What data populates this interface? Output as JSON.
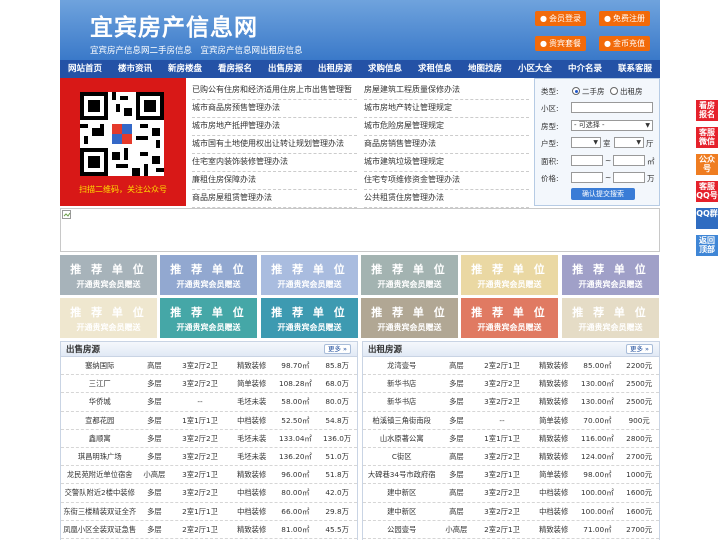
{
  "header": {
    "title": "宜宾房产信息网",
    "subtitle": "宜宾房产信息网二手房信息　宜宾房产信息网出租房信息",
    "buttons": [
      {
        "icon": "user-icon",
        "label": "会员登录"
      },
      {
        "icon": "register-icon",
        "label": "免费注册"
      },
      {
        "icon": "package-icon",
        "label": "贵宾套餐"
      },
      {
        "icon": "coin-icon",
        "label": "金币充值"
      }
    ]
  },
  "nav": [
    "网站首页",
    "楼市资讯",
    "新房楼盘",
    "看房报名",
    "出售房源",
    "出租房源",
    "求购信息",
    "求租信息",
    "地图找房",
    "小区大全",
    "中介名录",
    "联系客服"
  ],
  "qr": {
    "caption": "扫描二维码，关注公众号"
  },
  "news": {
    "left": [
      "已购公有住房和经济适用住房上市出售管理暂",
      "城市商品房预售管理办法",
      "城市房地产抵押管理办法",
      "城市国有土地使用权出让转让规划管理办法",
      "住宅室内装饰装修管理办法",
      "廉租住房保障办法",
      "商品房屋租赁管理办法"
    ],
    "right": [
      "房屋建筑工程质量保修办法",
      "城市房地产转让管理规定",
      "城市危险房屋管理规定",
      "商品房销售管理办法",
      "城市建筑垃圾管理规定",
      "住宅专项维修资金管理办法",
      "公共租赁住房管理办法"
    ]
  },
  "search": {
    "type_label": "类型:",
    "type_options": [
      "二手房",
      "出租房"
    ],
    "community_label": "小区:",
    "community_value": "",
    "layout_label": "房型:",
    "layout_value": "- 可选择 -",
    "units_label": "户型:",
    "room_unit": "室",
    "hall_unit": "厅",
    "area_label": "面积:",
    "area_unit": "㎡",
    "price_label": "价格:",
    "price_unit": "万",
    "range_sep": "~",
    "button": "确认提交搜索"
  },
  "tiles": {
    "line1": "推 荐 单 位",
    "line2": "开通贵宾会员赠送"
  },
  "tile_colors": [
    "#a7b3ba",
    "#92a8d0",
    "#a9bcdf",
    "#a3b3b1",
    "#ead8a3",
    "#a0a0c8",
    "#efe7cf",
    "#45a7a7",
    "#3d9ab1",
    "#b1a794",
    "#e07a62",
    "#e5dcc6"
  ],
  "sale": {
    "title": "出售房源",
    "more": "更多",
    "rows": [
      [
        "塞纳国际",
        "高层",
        "3室2厅2卫",
        "精致装修",
        "98.70㎡",
        "85.8万"
      ],
      [
        "三江厂",
        "多层",
        "3室2厅2卫",
        "简单装修",
        "108.28㎡",
        "68.0万"
      ],
      [
        "华侨城",
        "多层",
        "--",
        "毛坯未装",
        "58.00㎡",
        "80.0万"
      ],
      [
        "宣都花园",
        "多层",
        "1室1厅1卫",
        "中档装修",
        "52.50㎡",
        "54.8万"
      ],
      [
        "鑫顺寓",
        "多层",
        "3室2厅2卫",
        "毛坯未装",
        "133.04㎡",
        "136.0万"
      ],
      [
        "琪昌明珠广场",
        "多层",
        "3室2厅2卫",
        "毛坯未装",
        "136.20㎡",
        "51.0万"
      ],
      [
        "龙民苑附近单位宿舍",
        "小高层",
        "3室2厅1卫",
        "精致装修",
        "96.00㎡",
        "51.8万"
      ],
      [
        "交警队附近2楼中装修",
        "多层",
        "3室2厅2卫",
        "中档装修",
        "80.00㎡",
        "42.0万"
      ],
      [
        "东街三楼精装双证全齐",
        "多层",
        "2室1厅1卫",
        "中档装修",
        "66.00㎡",
        "29.8万"
      ],
      [
        "凤凰小区全装双证急售",
        "多层",
        "2室2厅1卫",
        "精致装修",
        "81.00㎡",
        "45.5万"
      ]
    ]
  },
  "rent": {
    "title": "出租房源",
    "more": "更多",
    "rows": [
      [
        "龙湾壹号",
        "高层",
        "2室2厅1卫",
        "精致装修",
        "85.00㎡",
        "2200元"
      ],
      [
        "新华书店",
        "多层",
        "3室2厅2卫",
        "精致装修",
        "130.00㎡",
        "2500元"
      ],
      [
        "新华书店",
        "多层",
        "3室2厅2卫",
        "精致装修",
        "130.00㎡",
        "2500元"
      ],
      [
        "柏溪镇三角街南段",
        "多层",
        "--",
        "简单装修",
        "70.00㎡",
        "900元"
      ],
      [
        "山水原著公寓",
        "多层",
        "1室1厅1卫",
        "精致装修",
        "116.00㎡",
        "2800元"
      ],
      [
        "C街区",
        "高层",
        "3室2厅2卫",
        "精致装修",
        "124.00㎡",
        "2700元"
      ],
      [
        "大碑巷34号市政府宿",
        "多层",
        "3室2厅1卫",
        "简单装修",
        "98.00㎡",
        "1000元"
      ],
      [
        "建中新区",
        "高层",
        "3室2厅2卫",
        "中档装修",
        "100.00㎡",
        "1600元"
      ],
      [
        "建中新区",
        "高层",
        "3室2厅2卫",
        "中档装修",
        "100.00㎡",
        "1600元"
      ],
      [
        "公园壹号",
        "小高层",
        "2室2厅1卫",
        "精致装修",
        "71.00㎡",
        "2700元"
      ]
    ]
  },
  "float_bar": [
    {
      "label": "看房报名",
      "color": "#e5212b"
    },
    {
      "label": "客服微信",
      "color": "#e5212b"
    },
    {
      "label": "公众号",
      "color": "#ef7d21"
    },
    {
      "label": "客服QQ号",
      "color": "#e5212b"
    },
    {
      "label": "QQ群",
      "color": "#2f6cc1"
    },
    {
      "label": "返回顶部",
      "color": "#3f86d6"
    }
  ]
}
